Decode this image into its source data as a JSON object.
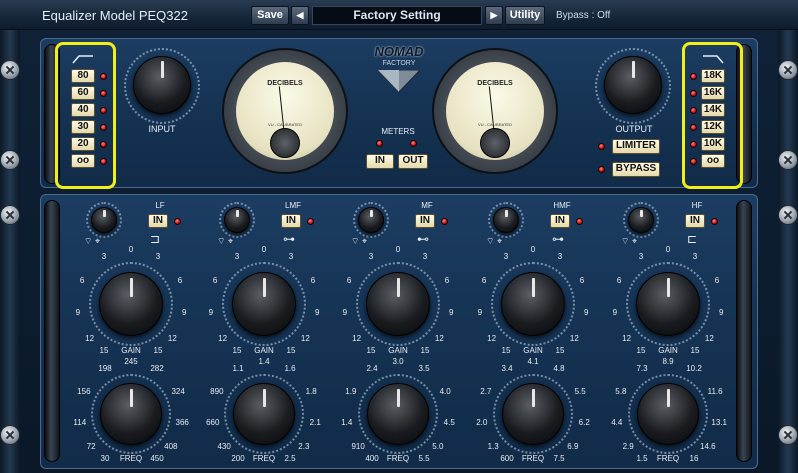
{
  "titlebar": {
    "title": "Equalizer Model PEQ322",
    "save_label": "Save",
    "prev_label": "◀",
    "preset_name": "Factory Setting",
    "next_label": "▶",
    "utility_label": "Utility",
    "bypass_status": "Bypass : Off"
  },
  "brand": {
    "logo_text": "NOMAD",
    "logo_sub": "FACTORY"
  },
  "hp_filter": {
    "icon": "highpass-icon",
    "options": [
      "80",
      "60",
      "40",
      "30",
      "20",
      "oo"
    ],
    "active": "oo"
  },
  "lp_filter": {
    "icon": "lowpass-icon",
    "options": [
      "18K",
      "16K",
      "14K",
      "12K",
      "10K",
      "oo"
    ],
    "active": "oo"
  },
  "input": {
    "label": "INPUT"
  },
  "output": {
    "label": "OUTPUT"
  },
  "meters": {
    "label": "METERS",
    "in_label": "IN",
    "out_label": "OUT",
    "face_title": "DECIBELS",
    "face_sub": "VU - CALIBRATED"
  },
  "limiter": {
    "label": "LIMITER"
  },
  "bypass": {
    "label": "BYPASS"
  },
  "bands": [
    {
      "name": "LF",
      "in": "IN",
      "gain_label": "GAIN",
      "freq_label": "FREQ",
      "gain_ticks": [
        "0",
        "3",
        "3",
        "6",
        "6",
        "9",
        "9",
        "12",
        "12",
        "15",
        "15"
      ],
      "freq_ticks": [
        "245",
        "198",
        "282",
        "156",
        "324",
        "114",
        "366",
        "72",
        "408",
        "30",
        "450"
      ]
    },
    {
      "name": "LMF",
      "in": "IN",
      "gain_label": "GAIN",
      "freq_label": "FREQ",
      "gain_ticks": [
        "0",
        "3",
        "3",
        "6",
        "6",
        "9",
        "9",
        "12",
        "12",
        "15",
        "15"
      ],
      "freq_ticks": [
        "1.4",
        "1.1",
        "1.6",
        "890",
        "1.8",
        "660",
        "2.1",
        "430",
        "2.3",
        "200",
        "2.5"
      ]
    },
    {
      "name": "MF",
      "in": "IN",
      "gain_label": "GAIN",
      "freq_label": "FREQ",
      "gain_ticks": [
        "0",
        "3",
        "3",
        "6",
        "6",
        "9",
        "9",
        "12",
        "12",
        "15",
        "15"
      ],
      "freq_ticks": [
        "3.0",
        "2.4",
        "3.5",
        "1.9",
        "4.0",
        "1.4",
        "4.5",
        "910",
        "5.0",
        "400",
        "5.5"
      ]
    },
    {
      "name": "HMF",
      "in": "IN",
      "gain_label": "GAIN",
      "freq_label": "FREQ",
      "gain_ticks": [
        "0",
        "3",
        "3",
        "6",
        "6",
        "9",
        "9",
        "12",
        "12",
        "15",
        "15"
      ],
      "freq_ticks": [
        "4.1",
        "3.4",
        "4.8",
        "2.7",
        "5.5",
        "2.0",
        "6.2",
        "1.3",
        "6.9",
        "600",
        "7.5"
      ]
    },
    {
      "name": "HF",
      "in": "IN",
      "gain_label": "GAIN",
      "freq_label": "FREQ",
      "gain_ticks": [
        "0",
        "3",
        "3",
        "6",
        "6",
        "9",
        "9",
        "12",
        "12",
        "15",
        "15"
      ],
      "freq_ticks": [
        "8.9",
        "7.3",
        "10.2",
        "5.8",
        "11.6",
        "4.4",
        "13.1",
        "2.9",
        "14.6",
        "1.5",
        "16"
      ]
    }
  ],
  "colors": {
    "panel": "#163455",
    "highlight": "#f2ee1a",
    "led": "#c01010"
  }
}
